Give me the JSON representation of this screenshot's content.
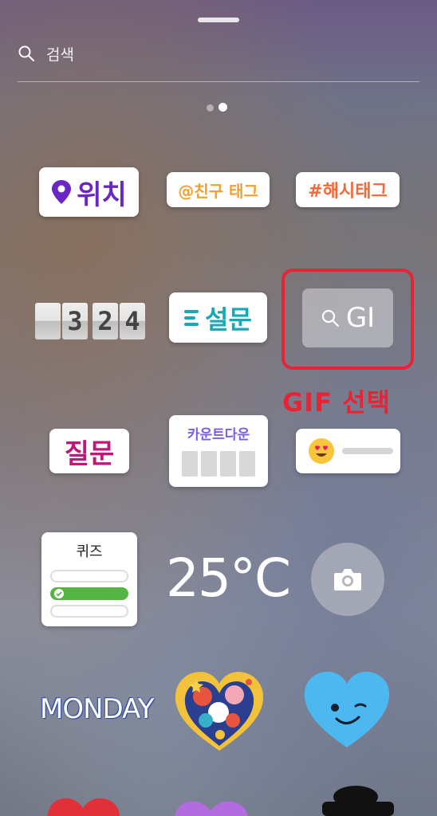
{
  "search": {
    "placeholder": "검색"
  },
  "stickers": {
    "location": "위치",
    "mention": "@친구 태그",
    "hashtag": "#해시태그",
    "countdown_time": [
      "3",
      "2",
      "4"
    ],
    "poll": "설문",
    "gif": "GI",
    "question": "질문",
    "countdown": "카운트다운",
    "quiz": "퀴즈",
    "temperature": "25°C",
    "monday": "MONDAY"
  },
  "annotation": {
    "caption": "GIF 선택",
    "color": "#e52535"
  },
  "colors": {
    "location": "#6a27c4",
    "poll": "#18a9b5",
    "question": "#c0177a",
    "quiz_correct": "#55b542",
    "heart": "#4db8f0"
  },
  "pager": {
    "pages": 2,
    "active": 2
  }
}
